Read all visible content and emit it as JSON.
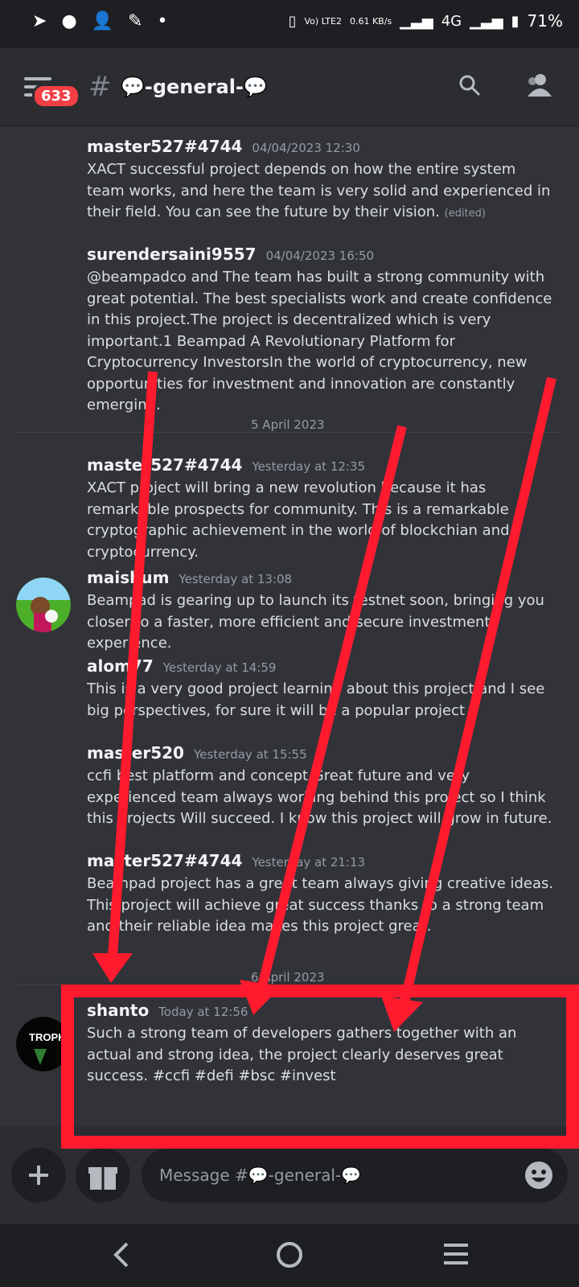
{
  "statusbar": {
    "left_icons": [
      "telegram-icon",
      "reddit-icon",
      "add-person-icon",
      "feather-icon",
      "dot-icon"
    ],
    "signal_text": "Vo) LTE2",
    "speed": "0.61 KB/s",
    "network": "4G",
    "battery": "71%"
  },
  "header": {
    "badge": "633",
    "hash": "#",
    "channel": "💬-general-💬"
  },
  "messages": [
    {
      "user": "master527#4744",
      "time": "04/04/2023 12:30",
      "text": "XACT  successful project depends on how the entire system team works, and here the team is very solid and experienced in their field. You can see the future by their vision.",
      "edited": "(edited)"
    },
    {
      "user": "surendersaini9557",
      "time": "04/04/2023 16:50",
      "text": "@beampadco and The team has built a strong community with great potential. The best specialists work and create confidence in this project.The project is decentralized which is very important.1 Beampad A Revolutionary Platform for Cryptocurrency InvestorsIn the world of cryptocurrency, new opportunities for investment and innovation are constantly emerging."
    },
    {
      "user": "master527#4744",
      "time": "Yesterday at 12:35",
      "text": "XACT project will bring a new revolution because it has remarkable prospects for community. This is a remarkable cryptographic achievement in the world of blockchian and cryptocurrency."
    },
    {
      "user": "maishum",
      "time": "Yesterday at 13:08",
      "text": "Beampad is gearing up to launch its testnet soon, bringing you closer to a faster, more efficient and secure investment experience."
    },
    {
      "user": "alom77",
      "time": "Yesterday at 14:59",
      "text": "This is a very good project learning about this project and I see big perspectives, for sure it will be a popular project"
    },
    {
      "user": "master520",
      "time": "Yesterday at 15:55",
      "text": "ccfi best platform and concept.Great future and very experienced team always working behind this project so I think this projects Will succeed. I know this project will grow in future."
    },
    {
      "user": "master527#4744",
      "time": "Yesterday at 21:13",
      "text": "Beampad project has a great team always giving creative ideas. This project will achieve great success thanks to a strong team and their reliable idea makes this project great."
    },
    {
      "user": "shanto",
      "time": "Today at 12:56",
      "text": "Such a strong team of developers gathers together with an actual and strong idea, the project clearly deserves great success. #ccfi #defi #bsc #invest"
    }
  ],
  "dividers": [
    "5 April 2023",
    "6 April 2023"
  ],
  "avatar_texts": {
    "shanto": "TROPH"
  },
  "composer": {
    "placeholder": "Message #💬-general-💬"
  },
  "annotation_color": "#ff1a2e"
}
